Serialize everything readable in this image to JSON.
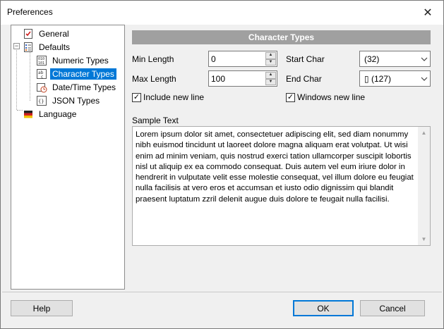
{
  "window": {
    "title": "Preferences",
    "close_glyph": "✕"
  },
  "tree": {
    "items": [
      {
        "label": "General",
        "icon": "general-doc-icon"
      },
      {
        "label": "Defaults",
        "icon": "defaults-icon",
        "expander": "−"
      },
      {
        "label": "Numeric Types",
        "icon": "numeric-types-icon"
      },
      {
        "label": "Character Types",
        "icon": "character-types-icon",
        "selected": true
      },
      {
        "label": "Date/Time Types",
        "icon": "datetime-types-icon"
      },
      {
        "label": "JSON Types",
        "icon": "json-types-icon"
      },
      {
        "label": "Language",
        "icon": "language-flag-icon"
      }
    ]
  },
  "section": {
    "title": "Character Types"
  },
  "fields": {
    "min_length_label": "Min Length",
    "min_length_value": "0",
    "max_length_label": "Max Length",
    "max_length_value": "100",
    "start_char_label": "Start Char",
    "start_char_value": "(32)",
    "end_char_label": "End Char",
    "end_char_value": " (127)",
    "end_char_glyph": "▯"
  },
  "checks": {
    "include_new_line": {
      "label": "Include new line",
      "checked": true
    },
    "windows_new_line": {
      "label": "Windows new line",
      "checked": true
    }
  },
  "sample": {
    "label": "Sample Text",
    "text": "Lorem ipsum dolor sit amet, consectetuer adipiscing elit, sed diam nonummy nibh euismod tincidunt ut laoreet dolore magna aliquam erat volutpat. Ut wisi enim ad minim veniam, quis nostrud exerci tation ullamcorper suscipit lobortis nisl ut aliquip ex ea commodo consequat. Duis autem vel eum iriure dolor in hendrerit in vulputate velit esse molestie consequat, vel illum dolore eu feugiat nulla facilisis at vero eros et accumsan et iusto odio dignissim qui blandit praesent luptatum zzril delenit augue duis dolore te feugait nulla facilisi."
  },
  "buttons": {
    "help": "Help",
    "ok": "OK",
    "cancel": "Cancel"
  },
  "colors": {
    "selection": "#0078d7",
    "header_bg": "#a0a0a0"
  }
}
